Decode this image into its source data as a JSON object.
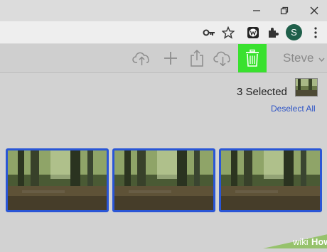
{
  "toolbar": {
    "user_name": "Steve"
  },
  "profile": {
    "initial": "S"
  },
  "selection": {
    "count_label": "3 Selected",
    "deselect_label": "Deselect All"
  },
  "photos": [
    "forest-photo",
    "forest-photo",
    "forest-photo"
  ],
  "watermark": {
    "brand_a": "wiki",
    "brand_b": "How"
  },
  "colors": {
    "highlight": "#39e12f",
    "selection_border": "#2a56d6",
    "link": "#2d54c6"
  }
}
